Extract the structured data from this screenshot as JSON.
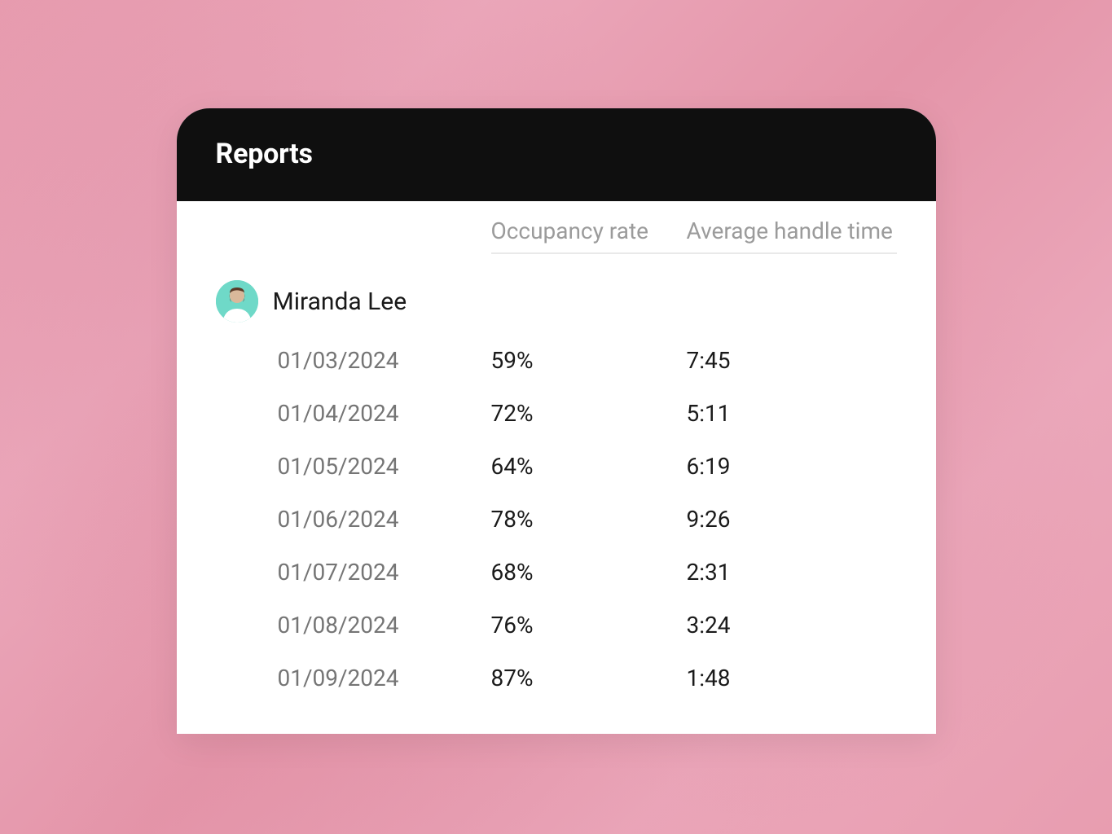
{
  "header": {
    "title": "Reports"
  },
  "columns": {
    "occupancy": "Occupancy rate",
    "aht": "Average handle time"
  },
  "user": {
    "name": "Miranda Lee",
    "avatar_bg": "#6fd9c8"
  },
  "rows": [
    {
      "date": "01/03/2024",
      "occupancy": "59%",
      "aht": "7:45"
    },
    {
      "date": "01/04/2024",
      "occupancy": "72%",
      "aht": "5:11"
    },
    {
      "date": "01/05/2024",
      "occupancy": "64%",
      "aht": "6:19"
    },
    {
      "date": "01/06/2024",
      "occupancy": "78%",
      "aht": "9:26"
    },
    {
      "date": "01/07/2024",
      "occupancy": "68%",
      "aht": "2:31"
    },
    {
      "date": "01/08/2024",
      "occupancy": "76%",
      "aht": "3:24"
    },
    {
      "date": "01/09/2024",
      "occupancy": "87%",
      "aht": "1:48"
    }
  ]
}
